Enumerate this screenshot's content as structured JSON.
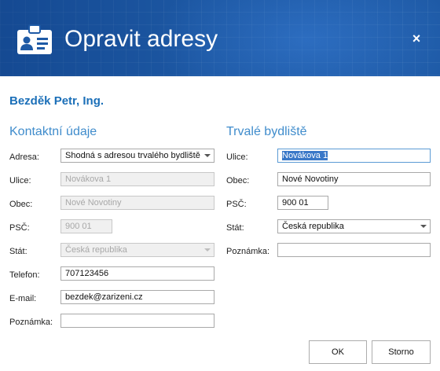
{
  "dialog": {
    "title": "Opravit adresy",
    "close_label": "×",
    "icon": "id-card-icon",
    "header_color": "#1e5aa6"
  },
  "person": {
    "name": "Bezděk Petr, Ing."
  },
  "contact": {
    "heading": "Kontaktní údaje",
    "address_label": "Adresa:",
    "address_value": "Shodná s adresou trvalého bydliště",
    "street_label": "Ulice:",
    "street_value": "Novákova 1",
    "city_label": "Obec:",
    "city_value": "Nové Novotiny",
    "zip_label": "PSČ:",
    "zip_value": "900 01",
    "country_label": "Stát:",
    "country_value": "Česká republika",
    "phone_label": "Telefon:",
    "phone_value": "707123456",
    "email_label": "E-mail:",
    "email_value": "bezdek@zarizeni.cz",
    "note_label": "Poznámka:",
    "note_value": ""
  },
  "permanent": {
    "heading": "Trvalé bydliště",
    "street_label": "Ulice:",
    "street_value": "Novákova 1",
    "city_label": "Obec:",
    "city_value": "Nové Novotiny",
    "zip_label": "PSČ:",
    "zip_value": "900 01",
    "country_label": "Stát:",
    "country_value": "Česká republika",
    "note_label": "Poznámka:",
    "note_value": ""
  },
  "buttons": {
    "ok_label": "OK",
    "cancel_label": "Storno"
  },
  "colors": {
    "accent": "#1b6fb8",
    "section": "#3f8ccc"
  }
}
